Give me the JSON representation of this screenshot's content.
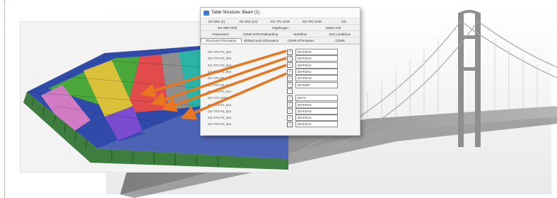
{
  "dialog": {
    "title": "Table Structure: Beam (1)",
    "tab_rows": [
      [
        "DS Skin (2)",
        "DS Skin (L2)",
        "DS TP1 SHR",
        "DS TR2 SHR",
        "DS"
      ],
      [
        "DS SBP Shift",
        "Diaphragm",
        "Object info"
      ],
      [
        "Parameters",
        "CDNR BTM Railmarking",
        "Workflow",
        "End conditions"
      ],
      [
        "Structural information",
        "Shifted track information",
        "CDNR BTM Beam",
        "CDNR"
      ]
    ],
    "rows": [
      {
        "name": "DS-TP1-P1_Bot",
        "checked": "✓",
        "value": "DS*FDAS"
      },
      {
        "name": "DS-TP1-P2_Bot",
        "checked": "✓",
        "value": "DS*FDAS"
      },
      {
        "name": "DS-TP1-P3_Bot",
        "checked": "✓",
        "value": "DS*FDAS"
      },
      {
        "name": "DS-TP1-P4_Bot",
        "checked": "✓",
        "value": "DS*FDAS"
      },
      {
        "name": "DS-TP1-P5_Bot",
        "checked": "✓",
        "value": "DS*FDAS"
      },
      {
        "name": "DS-TP1-P6_Bot",
        "checked": "✓",
        "value": "DS*DWT"
      },
      {
        "name": "DS-TP1-P7_Bot",
        "checked": "",
        "value": ""
      },
      {
        "name": "DS-TP1-SHR",
        "checked": "✓",
        "value": "DS*TI"
      },
      {
        "name": "DS-TP2-P1_Bot",
        "checked": "✓",
        "value": "DS*FDAS"
      },
      {
        "name": "DS-TP2-P2_Bot",
        "checked": "✓",
        "value": "DS*FDAS"
      },
      {
        "name": "DS-TP2-P3_Bot",
        "checked": "✓",
        "value": "DS*FDAS"
      },
      {
        "name": "DS-TP2-P4_Bot",
        "checked": "✓",
        "value": "DS*FDAS"
      }
    ]
  },
  "colors": {
    "arrow": "#e8761f",
    "deck_segments": [
      "#2f4aa8",
      "#4aa83b",
      "#e24b4b",
      "#8f8f8f",
      "#2bb3a6",
      "#7b4bd0",
      "#d07bc3",
      "#d9c23a"
    ],
    "bridge": "#9a9a9a"
  }
}
